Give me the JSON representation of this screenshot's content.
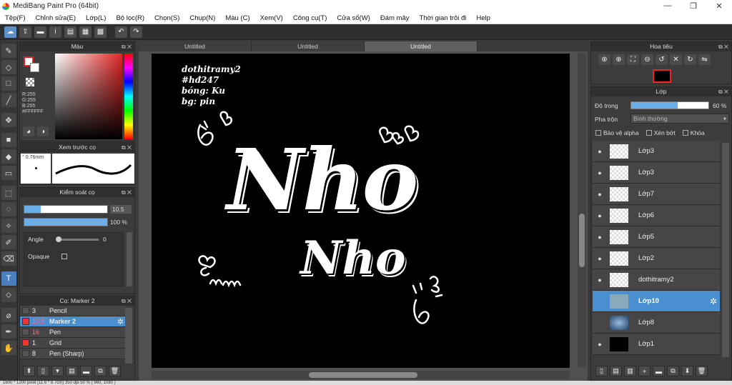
{
  "window": {
    "title": "MediBang Paint Pro (64bit)",
    "controls": [
      "—",
      "❐",
      "✕"
    ]
  },
  "menu": [
    "Tệp(F)",
    "Chỉnh sửa(E)",
    "Lớp(L)",
    "Bộ lọc(R)",
    "Chọn(S)",
    "Chụp(N)",
    "Màu (C)",
    "Xem(V)",
    "Công cụ(T)",
    "Cửa sổ(W)",
    "Đám mây",
    "Thời gian trôi đi",
    "Help"
  ],
  "tabs": [
    "Untitled",
    "Untitled",
    "Untitled"
  ],
  "color_panel": {
    "title": "Màu",
    "r": "R:255",
    "g": "G:255",
    "b": "B:255",
    "hex": "#FFFFFF",
    "accent": "#e32424"
  },
  "brush_preview": {
    "title": "Xem trước cọ",
    "size": "° 0.76mm"
  },
  "brush_control": {
    "title": "Kiểm soát cọ",
    "size_value": "10.5",
    "opacity_value": "100 %",
    "angle_label": "Angle",
    "angle_value": "0",
    "opaque_label": "Opaque"
  },
  "brush_list": {
    "title": "Cọ: Marker 2",
    "items": [
      {
        "num": "3",
        "name": "Pencil"
      },
      {
        "num": "10.5",
        "name": "Marker 2"
      },
      {
        "num": "16",
        "name": "Pen"
      },
      {
        "num": "1",
        "name": "Grid"
      },
      {
        "num": "8",
        "name": "Pen (Sharp)"
      }
    ]
  },
  "navigator": {
    "title": "Hoa tiêu"
  },
  "layers": {
    "title": "Lớp",
    "opacity_label": "Độ trong",
    "opacity_value": "60 %",
    "opacity_fraction": 0.6,
    "blend_label": "Pha trộn",
    "blend_value": "Bình thường",
    "check_alpha": "Bảo vệ alpha",
    "check_clip": "Xén bớt",
    "check_lock": "Khóa",
    "items": [
      {
        "name": "Lớp3"
      },
      {
        "name": "Lớp3"
      },
      {
        "name": "Lớp7"
      },
      {
        "name": "Lớp6"
      },
      {
        "name": "Lớp5"
      },
      {
        "name": "Lớp2"
      },
      {
        "name": "dothitramy2"
      },
      {
        "name": "Lớp10"
      },
      {
        "name": "Lớp8"
      },
      {
        "name": "Lớp1"
      }
    ]
  },
  "artwork": {
    "credit1": "dothitramy2",
    "credit2": "#hđ247",
    "credit3": "bóng: Ku",
    "credit4": "bg: pin",
    "word1": "Nho",
    "word2": "Nho"
  },
  "status": "1600 * 1200 pixel   (11.6 * 8.7cm)   350 dpi   50 %   ( 960, 1080 )"
}
